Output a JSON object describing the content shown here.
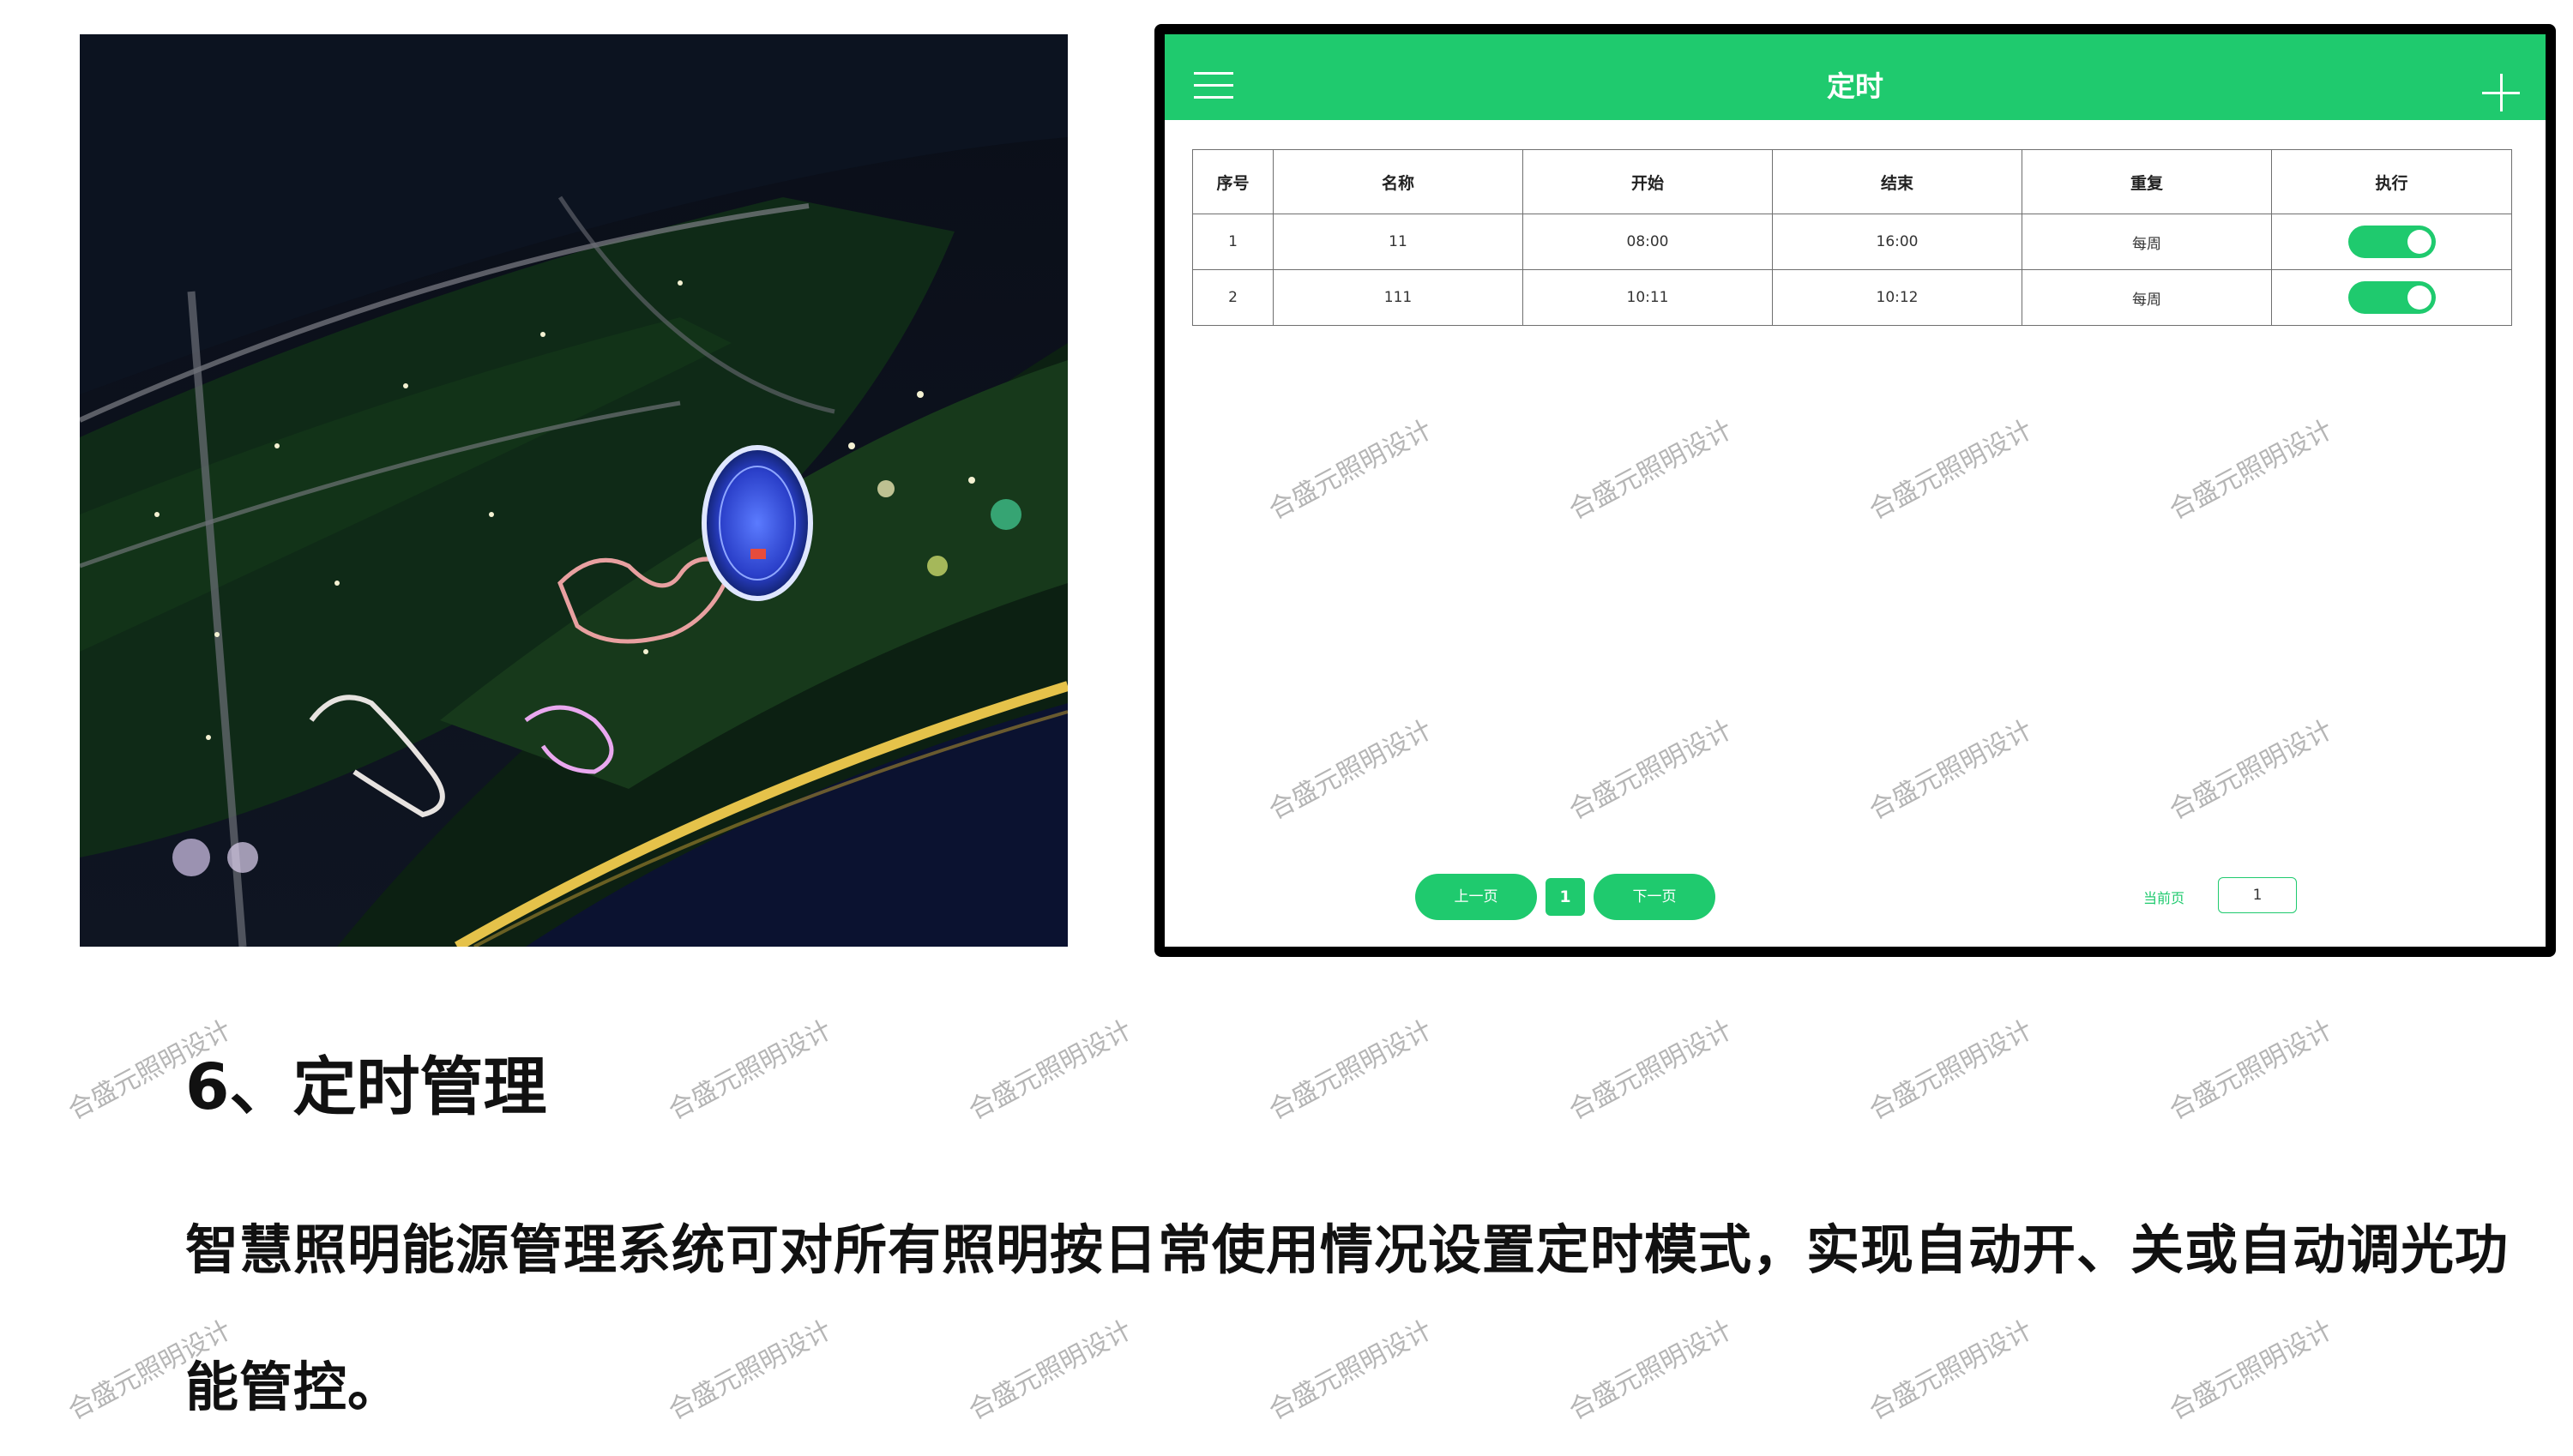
{
  "app": {
    "title": "定时",
    "icons": {
      "menu": "hamburger-menu-icon",
      "add": "plus-icon"
    },
    "accent_color": "#1fca6e",
    "table": {
      "headers": [
        "序号",
        "名称",
        "开始",
        "结束",
        "重复",
        "执行"
      ],
      "rows": [
        {
          "index": "1",
          "name": "11",
          "start": "08:00",
          "end": "16:00",
          "repeat": "每周",
          "enabled": true
        },
        {
          "index": "2",
          "name": "111",
          "start": "10:11",
          "end": "10:12",
          "repeat": "每周",
          "enabled": true
        }
      ]
    },
    "pagination": {
      "prev_label": "上一页",
      "current_page": "1",
      "next_label": "下一页",
      "current_label": "当前页",
      "current_input_value": "1"
    }
  },
  "section": {
    "heading": "6、定时管理",
    "paragraph": "智慧照明能源管理系统可对所有照明按日常使用情况设置定时模式，实现自动开、关或自动调光功能管控。"
  },
  "watermark": "合盛元照明设计"
}
